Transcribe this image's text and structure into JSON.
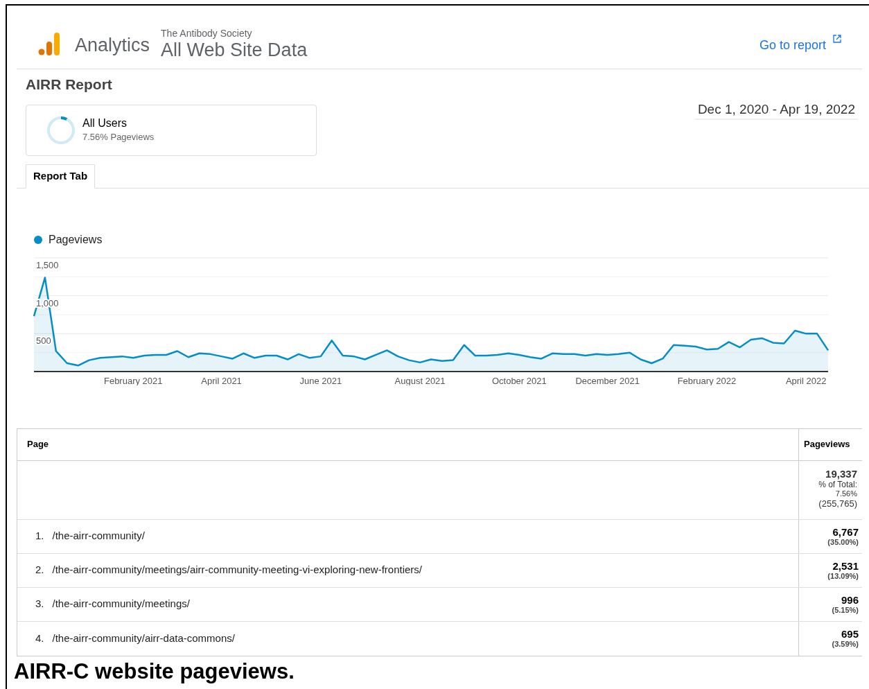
{
  "header": {
    "product": "Analytics",
    "account": "The Antibody Society",
    "property": "All Web Site Data",
    "link": "Go to report"
  },
  "report": {
    "title": "AIRR Report",
    "segment": {
      "name": "All Users",
      "detail": "7.56% Pageviews",
      "level": 0.0756
    },
    "date_range": "Dec 1, 2020 - Apr 19, 2022"
  },
  "tabs": [
    {
      "label": "Report Tab",
      "selected": true
    }
  ],
  "chart": {
    "chart_data": {
      "type": "area",
      "categories": [
        null,
        null,
        null,
        null,
        null,
        null,
        null,
        null,
        null,
        "February 2021",
        null,
        null,
        null,
        null,
        null,
        null,
        null,
        "April 2021",
        null,
        null,
        null,
        null,
        null,
        null,
        null,
        null,
        "June 2021",
        null,
        null,
        null,
        null,
        null,
        null,
        null,
        null,
        "August 2021",
        null,
        null,
        null,
        null,
        null,
        null,
        null,
        null,
        "October 2021",
        null,
        null,
        null,
        null,
        null,
        null,
        null,
        "December 2021",
        null,
        null,
        null,
        null,
        null,
        null,
        null,
        null,
        "February 2022",
        null,
        null,
        null,
        null,
        null,
        null,
        null,
        null,
        "April 2022",
        null,
        null
      ],
      "series": [
        {
          "name": "Pageviews",
          "color": "#058dc7",
          "values": [
            730,
            1240,
            270,
            110,
            80,
            150,
            180,
            190,
            200,
            180,
            210,
            220,
            220,
            270,
            190,
            240,
            230,
            200,
            170,
            240,
            180,
            210,
            210,
            160,
            230,
            180,
            200,
            410,
            210,
            200,
            160,
            220,
            280,
            200,
            150,
            120,
            160,
            140,
            150,
            350,
            210,
            210,
            220,
            240,
            220,
            190,
            170,
            240,
            230,
            230,
            210,
            230,
            220,
            230,
            250,
            160,
            110,
            170,
            350,
            340,
            330,
            290,
            300,
            390,
            320,
            420,
            440,
            380,
            370,
            540,
            500,
            500,
            280
          ]
        }
      ],
      "ylim": [
        0,
        1500
      ],
      "yticks": [
        {
          "value": 500,
          "label": "500"
        },
        {
          "value": 1000,
          "label": "1,000"
        },
        {
          "value": 1500,
          "label": "1,500"
        }
      ]
    }
  },
  "table": {
    "columns": [
      "Page",
      "Pageviews"
    ],
    "total": {
      "value": "19,337",
      "share_label": "% of Total:",
      "share": "7.56%",
      "overall": "(255,765)"
    },
    "rows": [
      {
        "rank": "1.",
        "page": "/the-airr-community/",
        "value": "6,767",
        "share": "(35.00%)"
      },
      {
        "rank": "2.",
        "page": "/the-airr-community/meetings/airr-community-meeting-vi-exploring-new-frontiers/",
        "value": "2,531",
        "share": "(13.09%)"
      },
      {
        "rank": "3.",
        "page": "/the-airr-community/meetings/",
        "value": "996",
        "share": "(5.15%)"
      },
      {
        "rank": "4.",
        "page": "/the-airr-community/airr-data-commons/",
        "value": "695",
        "share": "(3.59%)"
      }
    ]
  },
  "caption": "AIRR-C website pageviews."
}
